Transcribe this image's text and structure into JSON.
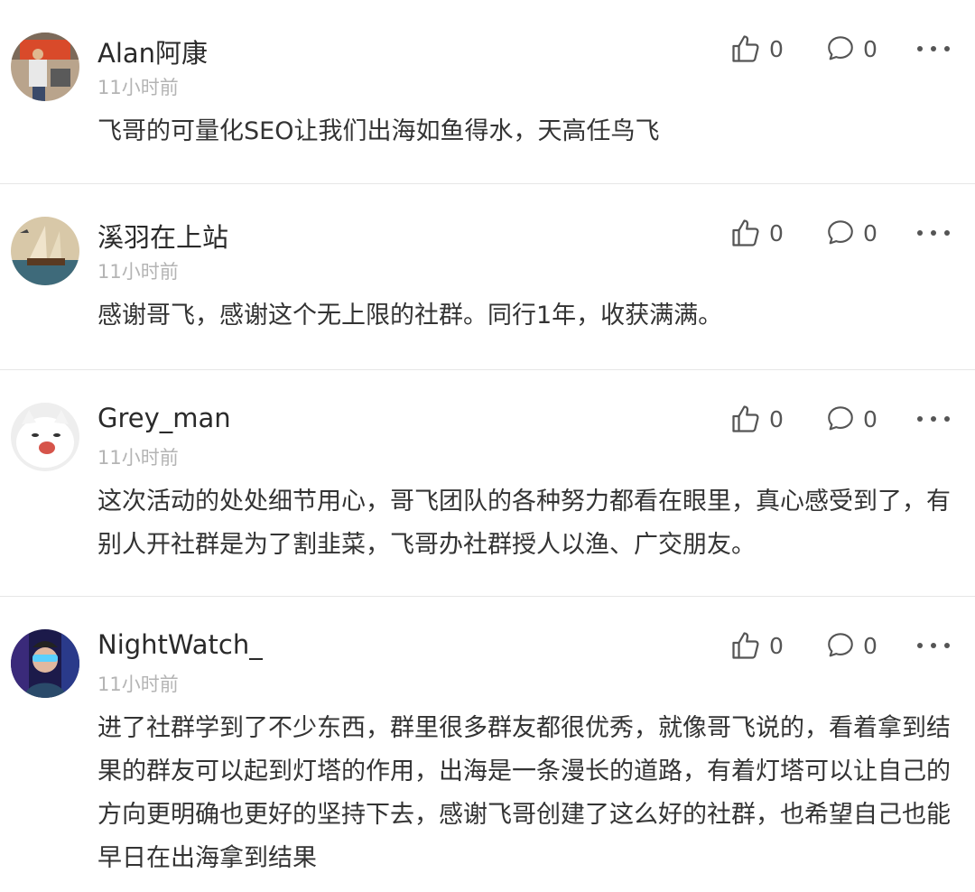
{
  "comments": [
    {
      "name": "Alan阿康",
      "time": "11小时前",
      "text": "飞哥的可量化SEO让我们出海如鱼得水，天高任鸟飞",
      "likes": "0",
      "replies": "0"
    },
    {
      "name": "溪羽在上站",
      "time": "11小时前",
      "text": "感谢哥飞，感谢这个无上限的社群。同行1年，收获满满。",
      "likes": "0",
      "replies": "0"
    },
    {
      "name": "Grey_man",
      "time": "11小时前",
      "text": "这次活动的处处细节用心，哥飞团队的各种努力都看在眼里，真心感受到了，有别人开社群是为了割韭菜，飞哥办社群授人以渔、广交朋友。",
      "likes": "0",
      "replies": "0"
    },
    {
      "name": "NightWatch_",
      "time": "11小时前",
      "text": "进了社群学到了不少东西，群里很多群友都很优秀，就像哥飞说的，看着拿到结果的群友可以起到灯塔的作用，出海是一条漫长的道路，有着灯塔可以让自己的方向更明确也更好的坚持下去，感谢飞哥创建了这么好的社群，也希望自己也能早日在出海拿到结果",
      "likes": "0",
      "replies": "0"
    }
  ],
  "icons": {
    "like": "thumbs-up-icon",
    "reply": "speech-bubble-icon",
    "more": "more-dots-icon"
  },
  "colors": {
    "name": "#2a2a2a",
    "time": "#b4b4b4",
    "body": "#333333",
    "divider": "#e6e6e6"
  }
}
